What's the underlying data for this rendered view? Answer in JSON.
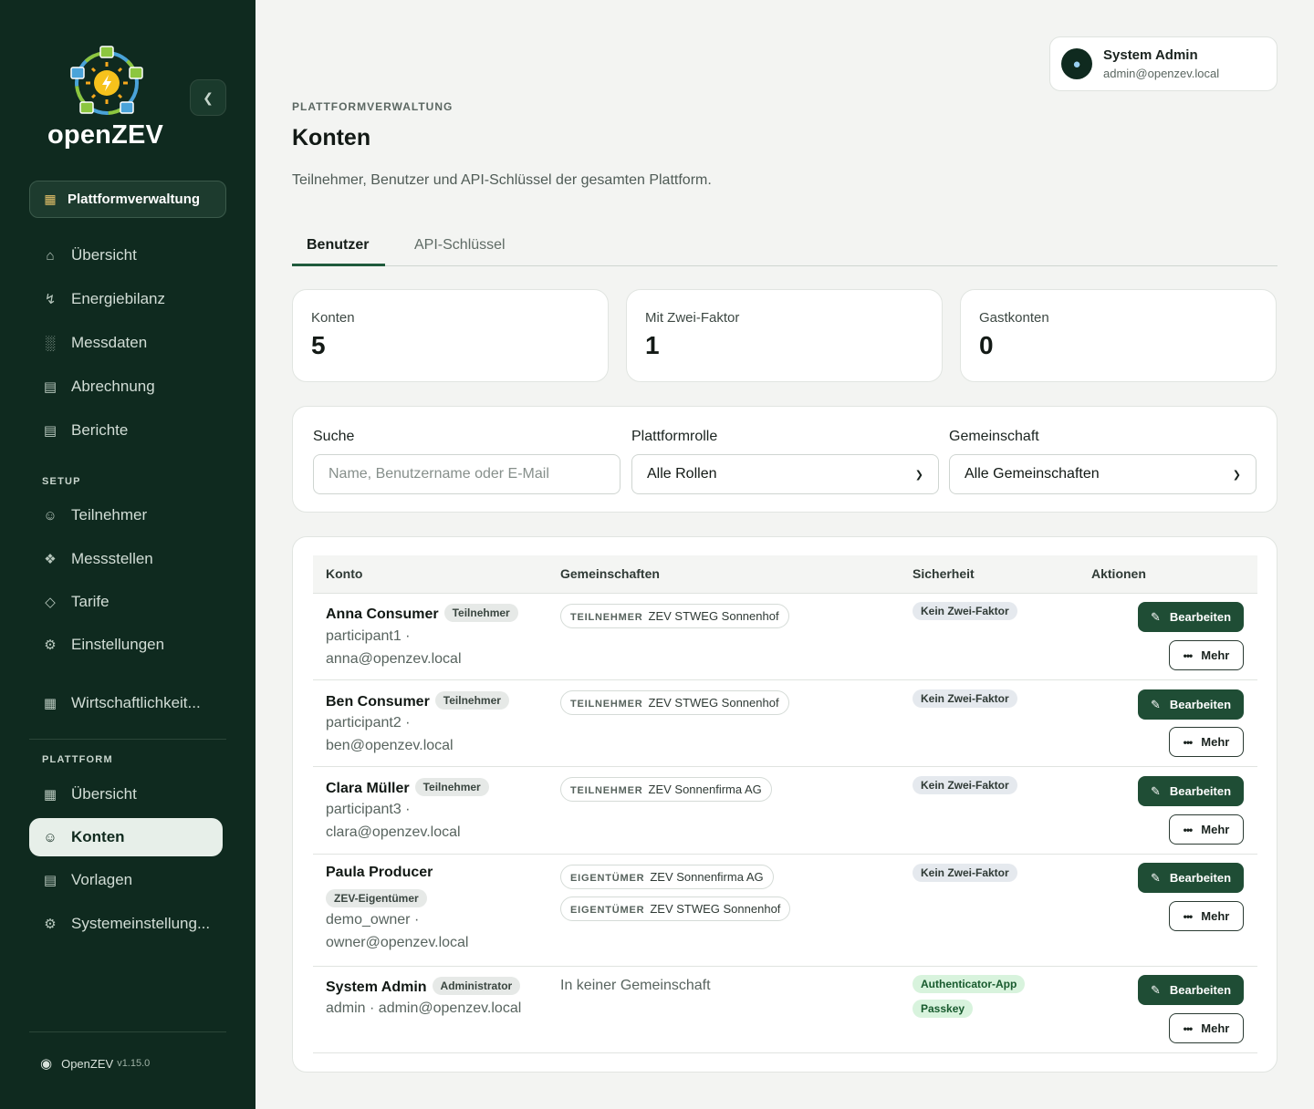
{
  "app": {
    "logo_text": "openZEV"
  },
  "sidebar": {
    "platform_pill": "Plattformverwaltung",
    "main_items": [
      {
        "label": "Übersicht",
        "icon": "home-icon"
      },
      {
        "label": "Energiebilanz",
        "icon": "bolt-icon"
      },
      {
        "label": "Messdaten",
        "icon": "bar-chart-icon"
      },
      {
        "label": "Abrechnung",
        "icon": "receipt-icon"
      },
      {
        "label": "Berichte",
        "icon": "document-icon"
      }
    ],
    "setup_label": "SETUP",
    "setup_items": [
      {
        "label": "Teilnehmer",
        "icon": "user-icon"
      },
      {
        "label": "Messstellen",
        "icon": "plug-icon"
      },
      {
        "label": "Tarife",
        "icon": "tag-icon"
      },
      {
        "label": "Einstellungen",
        "icon": "settings-icon"
      }
    ],
    "extra_item": {
      "label": "Wirtschaftlichkeit...",
      "icon": "calculator-icon"
    },
    "platform_label": "PLATTFORM",
    "platform_items": [
      {
        "label": "Übersicht",
        "icon": "dashboard-icon"
      },
      {
        "label": "Konten",
        "icon": "user-icon",
        "active": true
      },
      {
        "label": "Vorlagen",
        "icon": "template-icon"
      },
      {
        "label": "Systemeinstellung...",
        "icon": "settings-icon"
      }
    ],
    "footer": {
      "name": "OpenZEV",
      "version": "v1.15.0"
    }
  },
  "user": {
    "name": "System Admin",
    "email": "admin@openzev.local"
  },
  "header": {
    "eyebrow": "PLATTFORMVERWALTUNG",
    "title": "Konten",
    "description": "Teilnehmer, Benutzer und API-Schlüssel der gesamten Plattform."
  },
  "tabs": [
    {
      "label": "Benutzer",
      "active": true
    },
    {
      "label": "API-Schlüssel",
      "active": false
    }
  ],
  "stats": [
    {
      "label": "Konten",
      "value": "5"
    },
    {
      "label": "Mit Zwei-Faktor",
      "value": "1"
    },
    {
      "label": "Gastkonten",
      "value": "0"
    }
  ],
  "filters": {
    "search_label": "Suche",
    "search_placeholder": "Name, Benutzername oder E-Mail",
    "role_label": "Plattformrolle",
    "role_value": "Alle Rollen",
    "community_label": "Gemeinschaft",
    "community_value": "Alle Gemeinschaften"
  },
  "table": {
    "headers": [
      "Konto",
      "Gemeinschaften",
      "Sicherheit",
      "Aktionen"
    ],
    "edit_label": "Bearbeiten",
    "more_label": "Mehr",
    "rows": [
      {
        "name": "Anna Consumer",
        "role": "Teilnehmer",
        "meta1": "participant1 ·",
        "meta2": "anna@openzev.local",
        "communities": [
          {
            "role": "TEILNEHMER",
            "name": "ZEV STWEG Sonnenhof"
          }
        ],
        "security": [
          {
            "label": "Kein Zwei-Faktor",
            "ok": false
          }
        ]
      },
      {
        "name": "Ben Consumer",
        "role": "Teilnehmer",
        "meta1": "participant2 ·",
        "meta2": "ben@openzev.local",
        "communities": [
          {
            "role": "TEILNEHMER",
            "name": "ZEV STWEG Sonnenhof"
          }
        ],
        "security": [
          {
            "label": "Kein Zwei-Faktor",
            "ok": false
          }
        ]
      },
      {
        "name": "Clara Müller",
        "role": "Teilnehmer",
        "meta1": "participant3 ·",
        "meta2": "clara@openzev.local",
        "communities": [
          {
            "role": "TEILNEHMER",
            "name": "ZEV Sonnenfirma AG"
          }
        ],
        "security": [
          {
            "label": "Kein Zwei-Faktor",
            "ok": false
          }
        ]
      },
      {
        "name": "Paula Producer",
        "role": "ZEV-Eigentümer",
        "meta1": "demo_owner ·",
        "meta2": "owner@openzev.local",
        "communities": [
          {
            "role": "EIGENTÜMER",
            "name": "ZEV Sonnenfirma AG"
          },
          {
            "role": "EIGENTÜMER",
            "name": "ZEV STWEG Sonnenhof"
          }
        ],
        "security": [
          {
            "label": "Kein Zwei-Faktor",
            "ok": false
          }
        ]
      },
      {
        "name": "System Admin",
        "role": "Administrator",
        "meta1": "admin · admin@openzev.local",
        "meta2": "",
        "no_community": "In keiner Gemeinschaft",
        "security": [
          {
            "label": "Authenticator-App",
            "ok": true
          },
          {
            "label": "Passkey",
            "ok": true
          }
        ]
      }
    ]
  }
}
